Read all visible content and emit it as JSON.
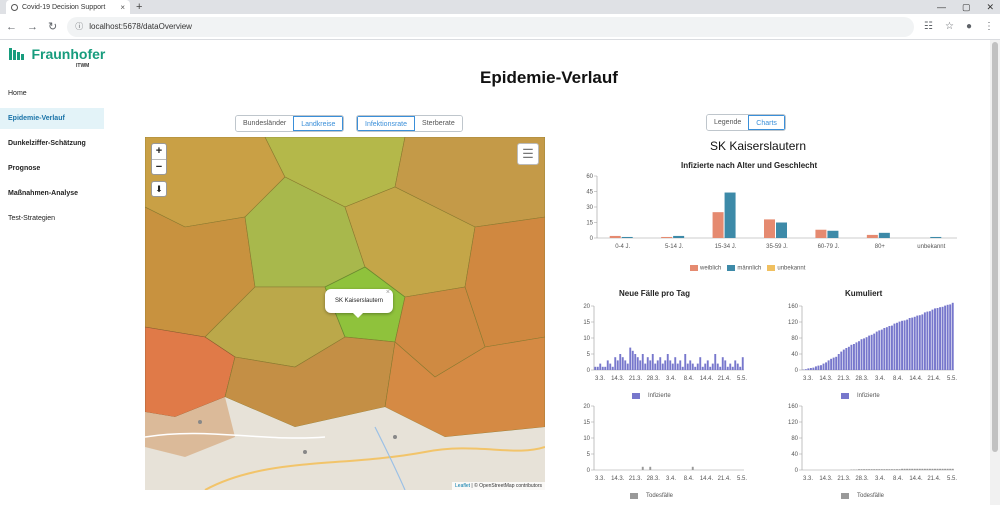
{
  "browser": {
    "tab_title": "Covid-19 Decision Support",
    "tab_close": "×",
    "new_tab": "+",
    "url": "localhost:5678/dataOverview",
    "controls": [
      "—",
      "▢",
      "✕"
    ]
  },
  "logo": {
    "name": "Fraunhofer",
    "sub": "ITWM"
  },
  "sidebar": {
    "items": [
      {
        "label": "Home"
      },
      {
        "label": "Epidemie-Verlauf"
      },
      {
        "label": "Dunkelziffer-Schätzung"
      },
      {
        "label": "Prognose"
      },
      {
        "label": "Maßnahmen-Analyse"
      },
      {
        "label": "Test-Strategien"
      }
    ]
  },
  "page": {
    "title": "Epidemie-Verlauf"
  },
  "toggles": {
    "region": [
      "Bundesländer",
      "Landkreise"
    ],
    "metric": [
      "Infektionsrate",
      "Sterberate"
    ],
    "panel": [
      "Legende",
      "Charts"
    ]
  },
  "map": {
    "zoom_in": "+",
    "zoom_out": "−",
    "popup": "SK Kaiserslautern",
    "popup_close": "×",
    "attrib_leaflet": "Leaflet",
    "attrib_rest": "| © OpenStreetMap contributors"
  },
  "region_title": "SK Kaiserslautern",
  "colors": {
    "weiblich": "#e58a70",
    "maennlich": "#3d8aa8",
    "unbekannt": "#f0c060",
    "infizierte": "#7777cc",
    "todesfaelle": "#999999"
  },
  "chart_data": [
    {
      "type": "bar",
      "title": "Infizierte nach Alter und Geschlecht",
      "categories": [
        "0-4 J.",
        "5-14 J.",
        "15-34 J.",
        "35-59 J.",
        "60-79 J.",
        "80+",
        "unbekannt"
      ],
      "series": [
        {
          "name": "weiblich",
          "values": [
            2,
            1,
            25,
            18,
            8,
            3,
            0
          ]
        },
        {
          "name": "männlich",
          "values": [
            1,
            2,
            44,
            15,
            7,
            5,
            1
          ]
        },
        {
          "name": "unbekannt",
          "values": [
            0,
            0,
            0,
            0,
            0,
            0,
            0
          ]
        }
      ],
      "yticks": [
        0,
        15,
        30,
        45,
        60
      ],
      "ylim": [
        0,
        60
      ]
    },
    {
      "type": "bar",
      "title": "Neue Fälle pro Tag",
      "xticks": [
        "3.3.",
        "14.3.",
        "21.3.",
        "28.3.",
        "3.4.",
        "8.4.",
        "14.4.",
        "21.4.",
        "5.5."
      ],
      "series": [
        {
          "name": "Infizierte",
          "values": [
            1,
            1,
            2,
            1,
            1,
            3,
            2,
            1,
            4,
            3,
            5,
            4,
            3,
            2,
            7,
            6,
            5,
            4,
            3,
            5,
            2,
            4,
            3,
            5,
            2,
            3,
            4,
            2,
            3,
            5,
            3,
            2,
            4,
            2,
            3,
            1,
            5,
            2,
            3,
            2,
            1,
            2,
            4,
            1,
            2,
            3,
            1,
            2,
            5,
            2,
            1,
            4,
            3,
            1,
            2,
            1,
            3,
            2,
            1,
            4
          ]
        }
      ],
      "yticks": [
        0,
        5,
        10,
        15,
        20
      ],
      "ylim": [
        0,
        20
      ]
    },
    {
      "type": "bar",
      "title": "Kumuliert",
      "xticks": [
        "3.3.",
        "14.3.",
        "21.3.",
        "28.3.",
        "3.4.",
        "8.4.",
        "14.4.",
        "21.4.",
        "5.5."
      ],
      "series": [
        {
          "name": "Infizierte",
          "values": [
            1,
            2,
            4,
            5,
            6,
            9,
            11,
            12,
            16,
            19,
            24,
            28,
            31,
            33,
            40,
            46,
            51,
            55,
            58,
            63,
            65,
            69,
            72,
            77,
            79,
            82,
            86,
            88,
            91,
            96,
            99,
            101,
            105,
            107,
            110,
            111,
            116,
            118,
            121,
            123,
            124,
            126,
            130,
            131,
            133,
            136,
            137,
            139,
            144,
            146,
            147,
            151,
            154,
            155,
            157,
            158,
            161,
            163,
            164,
            168
          ]
        }
      ],
      "yticks": [
        0,
        40,
        80,
        120,
        160
      ],
      "ylim": [
        0,
        160
      ]
    },
    {
      "type": "bar",
      "series_label": "Todesfälle",
      "xticks": [
        "3.3.",
        "14.3.",
        "21.3.",
        "28.3.",
        "3.4.",
        "8.4.",
        "14.4.",
        "21.4.",
        "5.5."
      ],
      "series": [
        {
          "name": "Todesfälle",
          "values": [
            0,
            0,
            0,
            0,
            0,
            0,
            0,
            0,
            0,
            0,
            0,
            0,
            0,
            0,
            0,
            0,
            0,
            0,
            0,
            1,
            0,
            0,
            1,
            0,
            0,
            0,
            0,
            0,
            0,
            0,
            0,
            0,
            0,
            0,
            0,
            0,
            0,
            0,
            0,
            1,
            0,
            0,
            0,
            0,
            0,
            0,
            0,
            0,
            0,
            0,
            0,
            0,
            0,
            0,
            0,
            0,
            0,
            0,
            0,
            0
          ]
        }
      ],
      "yticks": [
        0,
        5,
        10,
        15,
        20
      ],
      "ylim": [
        0,
        20
      ]
    },
    {
      "type": "bar",
      "series_label": "Todesfälle",
      "xticks": [
        "3.3.",
        "14.3.",
        "21.3.",
        "28.3.",
        "3.4.",
        "8.4.",
        "14.4.",
        "21.4.",
        "5.5."
      ],
      "series": [
        {
          "name": "Todesfälle",
          "values": [
            0,
            0,
            0,
            0,
            0,
            0,
            0,
            0,
            0,
            0,
            0,
            0,
            0,
            0,
            0,
            0,
            0,
            0,
            0,
            1,
            1,
            1,
            2,
            2,
            2,
            2,
            2,
            2,
            2,
            2,
            2,
            2,
            2,
            2,
            2,
            2,
            2,
            2,
            2,
            3,
            3,
            3,
            3,
            3,
            3,
            3,
            3,
            3,
            3,
            3,
            3,
            3,
            3,
            3,
            3,
            3,
            3,
            3,
            3,
            3
          ]
        }
      ],
      "yticks": [
        0,
        40,
        80,
        120,
        160
      ],
      "ylim": [
        0,
        160
      ]
    }
  ]
}
